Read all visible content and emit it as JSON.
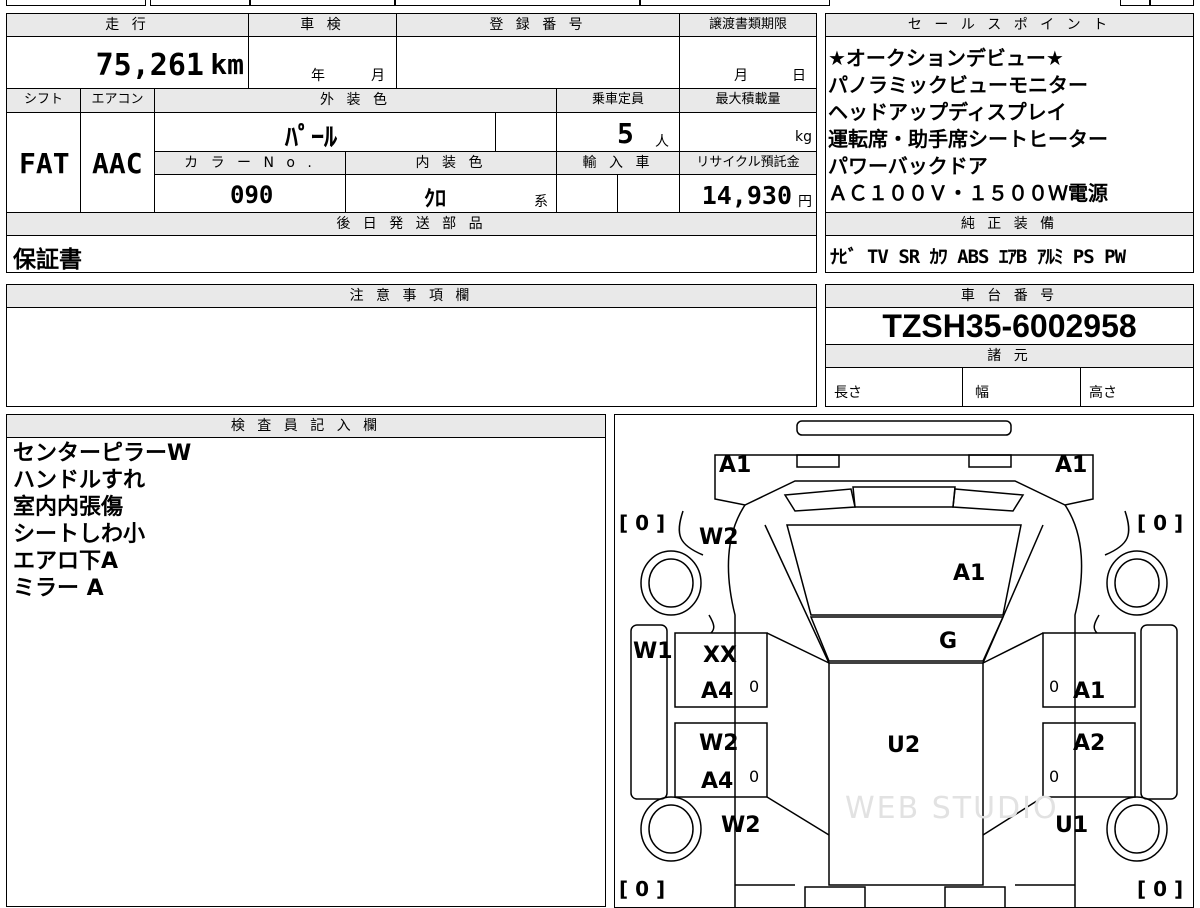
{
  "vehicle": {
    "mileage": {
      "header": "走 行",
      "value": "75,261",
      "unit": "km"
    },
    "inspection": {
      "header": "車 検",
      "year_label": "年",
      "month_label": "月"
    },
    "registration": {
      "header": "登 録 番 号"
    },
    "transfer_deadline": {
      "header": "譲渡書類期限",
      "month_label": "月",
      "day_label": "日"
    },
    "shift": {
      "header": "シフト",
      "value": "FAT"
    },
    "aircon": {
      "header": "エアコン",
      "value": "AAC"
    },
    "exterior_color": {
      "header": "外 装 色",
      "value": "ﾊﾟｰﾙ"
    },
    "capacity": {
      "header": "乗車定員",
      "value": "5",
      "unit": "人"
    },
    "max_load": {
      "header": "最大積載量",
      "unit": "kg"
    },
    "color_no": {
      "header": "カ ラ ー N o .",
      "value": "090"
    },
    "interior_color": {
      "header": "内 装 色",
      "value": "ｸﾛ",
      "suffix": "系"
    },
    "import": {
      "header": "輸 入 車"
    },
    "recycle": {
      "header": "リサイクル預託金",
      "value": "14,930",
      "unit": "円"
    },
    "later_parts": {
      "header": "後 日 発 送 部 品",
      "value": "保証書"
    },
    "notes": {
      "header": "注 意 事 項 欄"
    },
    "chassis": {
      "header": "車 台 番 号",
      "value": "TZSH35-6002958"
    },
    "specs": {
      "header": "諸 元",
      "length": "長さ",
      "width": "幅",
      "height": "高さ"
    }
  },
  "sales_points": {
    "header": "セ ー ル ス ポ イ ン ト",
    "lines": [
      "★オークションデビュー★",
      "パノラミックビューモニター",
      "ヘッドアップディスプレイ",
      "運転席・助手席シートヒーター",
      "パワーバックドア",
      "ＡＣ１００Ｖ・１５００Ｗ電源"
    ]
  },
  "equipment": {
    "header": "純 正 装 備",
    "items": [
      "ﾅﾋﾞ",
      "TV",
      "SR",
      "ｶﾜ",
      "ABS",
      "ｴｱB",
      "ｱﾙﾐ",
      "PS",
      "PW"
    ]
  },
  "inspector": {
    "header": "検 査 員 記 入 欄",
    "lines": [
      "センターピラーW",
      "ハンドルすれ",
      "室内内張傷",
      "シートしわ小",
      "エアロ下A",
      "ミラー A"
    ]
  },
  "diagram": {
    "tire_fl": "[ 0 ]",
    "tire_fr": "[ 0 ]",
    "tire_rl": "[ 0 ]",
    "tire_rr": "[ 0 ]",
    "front_left": "A1",
    "front_right": "A1",
    "hood": "A1",
    "windshield": "G",
    "roof": "U2",
    "fender_left": "W2",
    "pillar_left": "W1",
    "door_front_left_1": "XX",
    "door_front_left_2": "A4",
    "door_front_left_mark": "0",
    "door_rear_left_1": "W2",
    "door_rear_left_2": "A4",
    "door_rear_left_mark": "0",
    "door_front_right": "A1",
    "door_front_right_mark": "0",
    "door_rear_right": "A2",
    "door_rear_right_mark": "0",
    "rear_left": "W2",
    "rear_right": "U1",
    "watermark": "WEB STUDIO"
  }
}
